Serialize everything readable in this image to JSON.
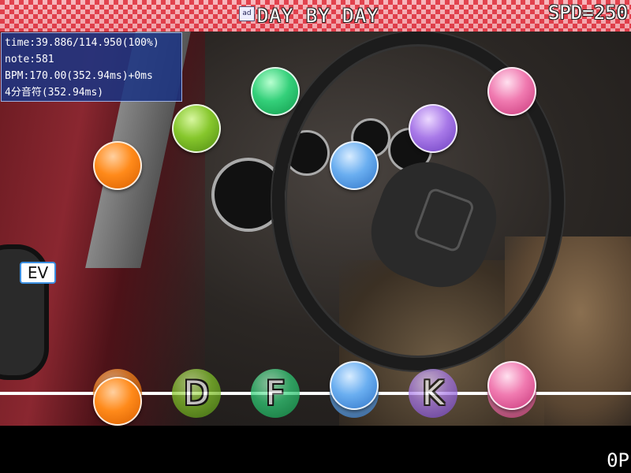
{
  "header": {
    "app_icon_label": "ad",
    "song_title": "DAY BY DAY",
    "speed": "SPD=250"
  },
  "info": {
    "time": "time:39.886/114.950(100%)",
    "note": "note:581",
    "bpm": "BPM:170.00(352.94ms)+0ms",
    "division": "4分音符(352.94ms)"
  },
  "ev_label": "EV",
  "lanes": [
    {
      "key": "",
      "color": "#ff8a1a"
    },
    {
      "key": "D",
      "color": "#86c72c"
    },
    {
      "key": "F",
      "color": "#34d07a"
    },
    {
      "key": "",
      "color": "#6aaef0"
    },
    {
      "key": "K",
      "color": "#a879e8"
    },
    {
      "key": "",
      "color": "#f07ab0"
    }
  ],
  "footer": {
    "score": "0P"
  }
}
